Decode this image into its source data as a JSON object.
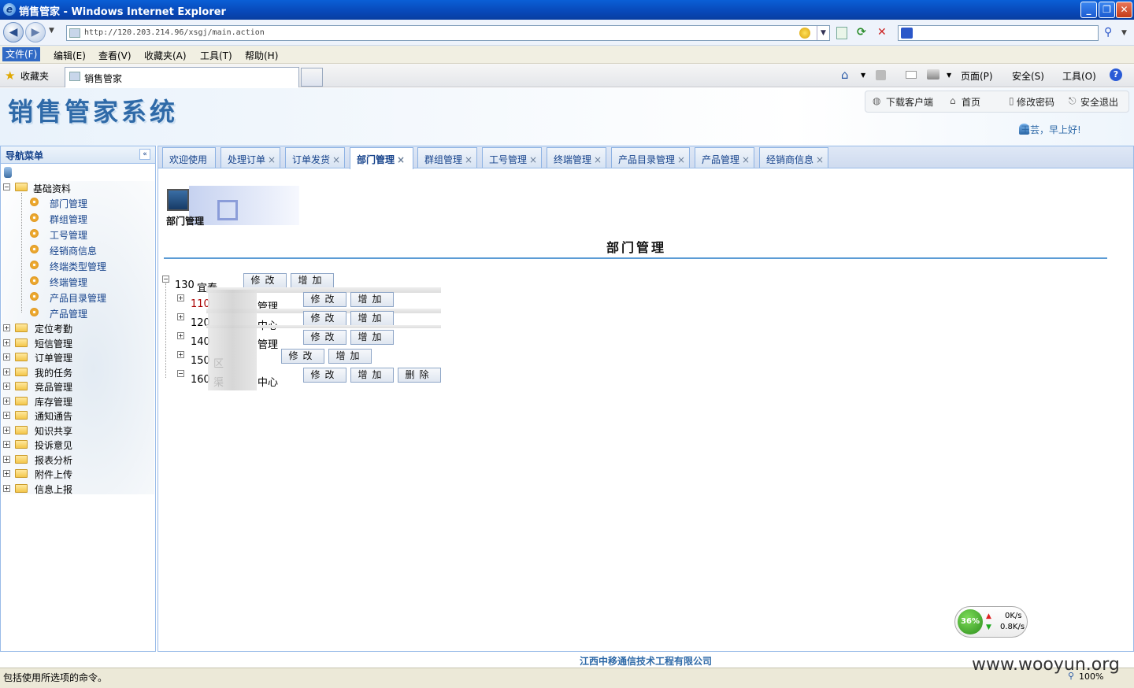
{
  "window": {
    "title": "销售管家 - Windows Internet Explorer",
    "minimize": "_",
    "restore": "❐",
    "close": "✕"
  },
  "address": {
    "url": "http://120.203.214.96/xsgj/main.action",
    "search_value": ""
  },
  "menubar": [
    "文件(F)",
    "编辑(E)",
    "查看(V)",
    "收藏夹(A)",
    "工具(T)",
    "帮助(H)"
  ],
  "favbar": {
    "favorites": "收藏夹",
    "tab_title": "销售管家",
    "page_menu": "页面(P)",
    "safety_menu": "安全(S)",
    "tools_menu": "工具(O)"
  },
  "app": {
    "logo": "销售管家系统",
    "links": [
      "下载客户端",
      "首页",
      "修改密码",
      "安全退出"
    ],
    "greeting": "王芸，早上好!"
  },
  "nav": {
    "header": "导航菜单",
    "root": "基础资料",
    "children": [
      "部门管理",
      "群组管理",
      "工号管理",
      "经销商信息",
      "终端类型管理",
      "终端管理",
      "产品目录管理",
      "产品管理"
    ],
    "groups": [
      "定位考勤",
      "短信管理",
      "订单管理",
      "我的任务",
      "竞品管理",
      "库存管理",
      "通知通告",
      "知识共享",
      "投诉意见",
      "报表分析",
      "附件上传",
      "信息上报"
    ]
  },
  "tabs": [
    {
      "label": "欢迎使用",
      "closable": false
    },
    {
      "label": "处理订单",
      "closable": true
    },
    {
      "label": "订单发货",
      "closable": true
    },
    {
      "label": "部门管理",
      "closable": true,
      "active": true
    },
    {
      "label": "群组管理",
      "closable": true
    },
    {
      "label": "工号管理",
      "closable": true
    },
    {
      "label": "终端管理",
      "closable": true
    },
    {
      "label": "产品目录管理",
      "closable": true
    },
    {
      "label": "产品管理",
      "closable": true
    },
    {
      "label": "经销商信息",
      "closable": true
    }
  ],
  "tab_close": "×",
  "page": {
    "label": "部门管理",
    "title": "部门管理",
    "root_dept": {
      "code": "130",
      "name": "宜春"
    },
    "depts": [
      {
        "code": "110",
        "tail": "管理"
      },
      {
        "code": "120",
        "tail": "中心"
      },
      {
        "code": "140",
        "tail": "管理"
      },
      {
        "code": "150",
        "tail": "区"
      },
      {
        "code": "160",
        "tail": "中心",
        "prefix": "渠"
      }
    ],
    "btn_edit": "修改",
    "btn_add": "增加",
    "btn_delete": "删除"
  },
  "footer": "江西中移通信技术工程有限公司",
  "status": {
    "text": "包括使用所选项的命令。",
    "zoom": "100%"
  },
  "net_widget": {
    "percent": "36%",
    "up": "0K/s",
    "down": "0.8K/s"
  },
  "watermark": "www.wooyun.org"
}
